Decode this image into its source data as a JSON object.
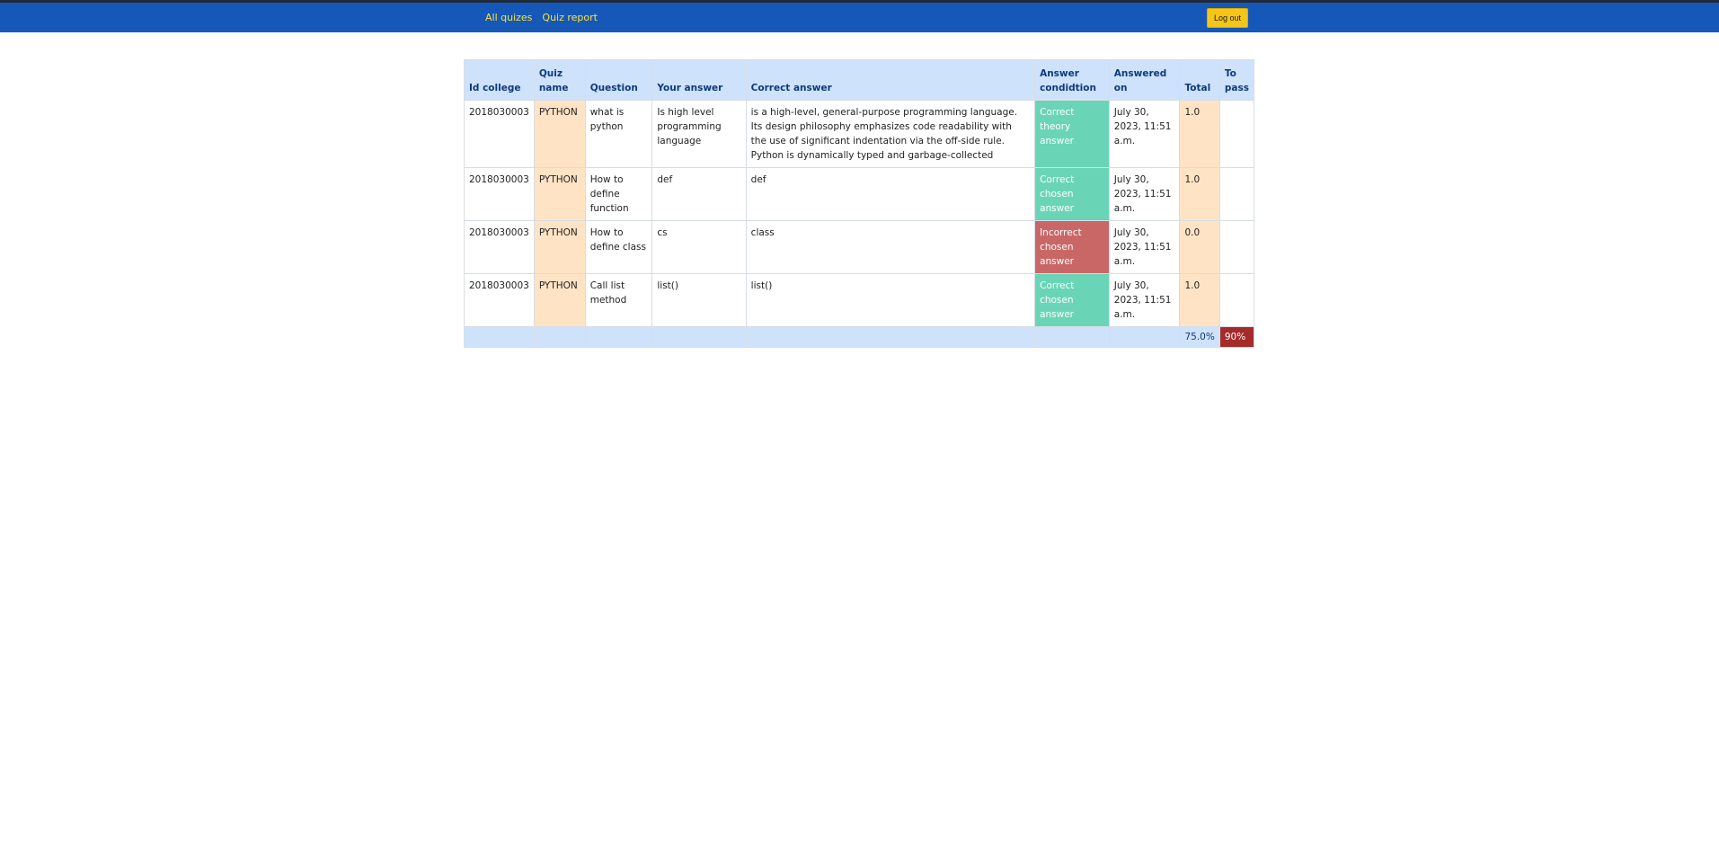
{
  "nav": {
    "links": [
      "All quizes",
      "Quiz report"
    ],
    "logout_label": "Log out"
  },
  "table": {
    "headers": [
      "Id college",
      "Quiz name",
      "Question",
      "Your answer",
      "Correct answer",
      "Answer condidtion",
      "Answered on",
      "Total",
      "To pass"
    ],
    "rows": [
      {
        "id_college": "2018030003",
        "quiz_name": "PYTHON",
        "question": "what is python",
        "your_answer": "Is high level programming language",
        "correct_answer": "is a high-level, general-purpose programming language. Its design philosophy emphasizes code readability with the use of significant indentation via the off-side rule. Python is dynamically typed and garbage-collected",
        "condition": "Correct theory answer",
        "condition_status": "correct",
        "answered_on": "July 30, 2023, 11:51 a.m.",
        "total": "1.0",
        "to_pass": ""
      },
      {
        "id_college": "2018030003",
        "quiz_name": "PYTHON",
        "question": "How to define function",
        "your_answer": "def",
        "correct_answer": "def",
        "condition": "Correct chosen answer",
        "condition_status": "correct",
        "answered_on": "July 30, 2023, 11:51 a.m.",
        "total": "1.0",
        "to_pass": ""
      },
      {
        "id_college": "2018030003",
        "quiz_name": "PYTHON",
        "question": "How to define class",
        "your_answer": "cs",
        "correct_answer": "class",
        "condition": "Incorrect chosen answer",
        "condition_status": "incorrect",
        "answered_on": "July 30, 2023, 11:51 a.m.",
        "total": "0.0",
        "to_pass": ""
      },
      {
        "id_college": "2018030003",
        "quiz_name": "PYTHON",
        "question": "Call list method",
        "your_answer": "list()",
        "correct_answer": "list()",
        "condition": "Correct chosen answer",
        "condition_status": "correct",
        "answered_on": "July 30, 2023, 11:51 a.m.",
        "total": "1.0",
        "to_pass": ""
      }
    ],
    "summary": {
      "total_percent": "75.0%",
      "to_pass": "90%"
    }
  },
  "colors": {
    "navbar": "#1558b8",
    "nav_link": "#ffe332",
    "logout_button": "#f5c518",
    "header_bg": "#cfe2fc",
    "quiz_total_bg": "#ffe3c5",
    "correct_bg": "#6ad5b6",
    "incorrect_bg": "#c96767",
    "to_pass_bg": "#a52a2a"
  }
}
